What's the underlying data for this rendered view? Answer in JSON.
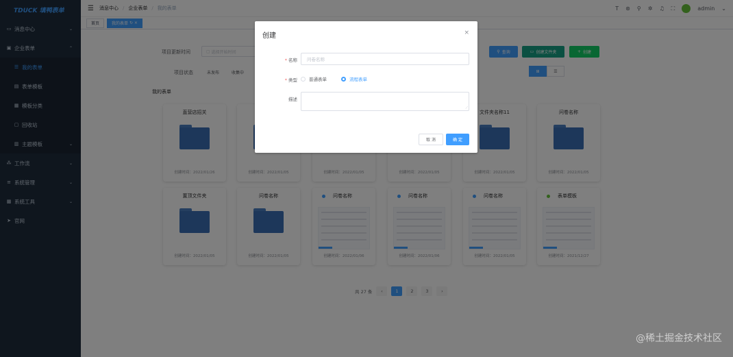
{
  "app": {
    "logo_text": "TDUCK 填鸭表单"
  },
  "sidebar": {
    "items": [
      {
        "label": "消息中心",
        "icon": "chat-icon"
      },
      {
        "label": "企业表单",
        "icon": "doc-icon"
      },
      {
        "label": "我的表单",
        "icon": "list-icon"
      },
      {
        "label": "表单模板",
        "icon": "template-icon"
      },
      {
        "label": "模板分类",
        "icon": "category-icon"
      },
      {
        "label": "回收站",
        "icon": "trash-icon"
      },
      {
        "label": "主题模板",
        "icon": "theme-icon"
      },
      {
        "label": "工作流",
        "icon": "flow-icon"
      },
      {
        "label": "系统管理",
        "icon": "system-icon"
      },
      {
        "label": "系统工具",
        "icon": "tool-icon"
      },
      {
        "label": "官网",
        "icon": "send-icon"
      }
    ]
  },
  "navbar": {
    "breadcrumb": [
      "消息中心",
      "企业表单",
      "我的表单"
    ],
    "user": "admin"
  },
  "tags": {
    "home": "首页",
    "current": "我的表单"
  },
  "filters": {
    "time_label": "项目更新时间",
    "time_placeholder": "选择开始时间",
    "status_label": "项目状态",
    "status_options": [
      "未发布",
      "收集中"
    ]
  },
  "actions": {
    "query": "查询",
    "new_folder": "创建文件夹",
    "create": "创建"
  },
  "section_title": "我的表单",
  "cards_row1": [
    {
      "title": "直营店招关",
      "time": "创建时间：2022/01/26"
    },
    {
      "title": "",
      "time": "创建时间：2022/01/05"
    },
    {
      "title": "",
      "time": "创建时间：2022/01/05"
    },
    {
      "title": "",
      "time": "创建时间：2022/01/05"
    },
    {
      "title": "文件夹名称11",
      "time": "创建时间：2022/01/05"
    },
    {
      "title": "问卷名称",
      "time": "创建时间：2022/01/05"
    }
  ],
  "cards_row2": [
    {
      "title": "置顶文件夹",
      "time": "创建时间：2022/01/05"
    },
    {
      "title": "问卷名称",
      "time": "创建时间：2022/01/05"
    },
    {
      "title": "问卷名称",
      "time": "创建时间：2022/01/06"
    },
    {
      "title": "问卷名称",
      "time": "创建时间：2022/01/06"
    },
    {
      "title": "问卷名称",
      "time": "创建时间：2022/01/05"
    },
    {
      "title": "表单模板",
      "time": "创建时间：2021/12/27"
    }
  ],
  "pagination": {
    "total": "共 27 条",
    "pages": [
      "1",
      "2",
      "3"
    ],
    "current": "1"
  },
  "dialog": {
    "title": "创建",
    "name_label": "名称",
    "name_placeholder": "问卷名称",
    "type_label": "类型",
    "type_options": [
      "普通表单",
      "流程表单"
    ],
    "type_selected": "流程表单",
    "desc_label": "描述",
    "cancel": "取 消",
    "confirm": "确 定"
  },
  "watermark": "@稀土掘金技术社区"
}
